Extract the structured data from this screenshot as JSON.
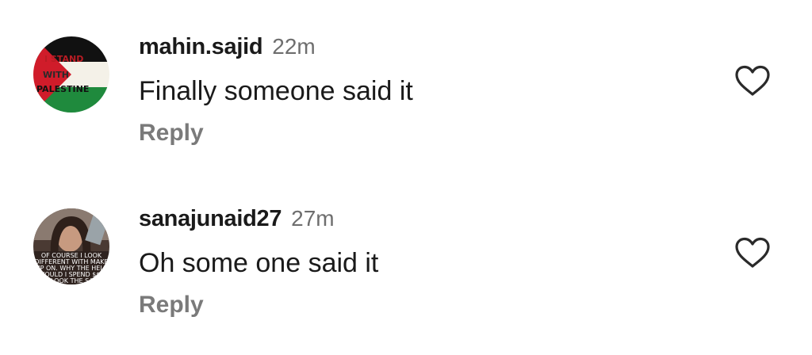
{
  "comments": [
    {
      "username": "mahin.sajid",
      "time": "22m",
      "text": "Finally someone said it",
      "reply_label": "Reply",
      "avatar": {
        "type": "flag",
        "lines": [
          "I STAND",
          "WITH",
          "PALESTINE"
        ],
        "colors": {
          "top": "#111111",
          "middle": "#f4f1e8",
          "bottom": "#1f8a3d",
          "triangle": "#d01c2a"
        }
      },
      "like_icon": "heart-outline-icon"
    },
    {
      "username": "sanajunaid27",
      "time": "27m",
      "text": "Oh some one said it",
      "reply_label": "Reply",
      "avatar": {
        "type": "photo",
        "lines": [
          "OF COURSE I LOOK",
          "DIFFERENT WITH MAKE",
          "UP ON. WHY THE HELL",
          "WOULD I SPEND $$$",
          "TO LOOK THE SAME"
        ]
      },
      "like_icon": "heart-outline-icon"
    }
  ]
}
